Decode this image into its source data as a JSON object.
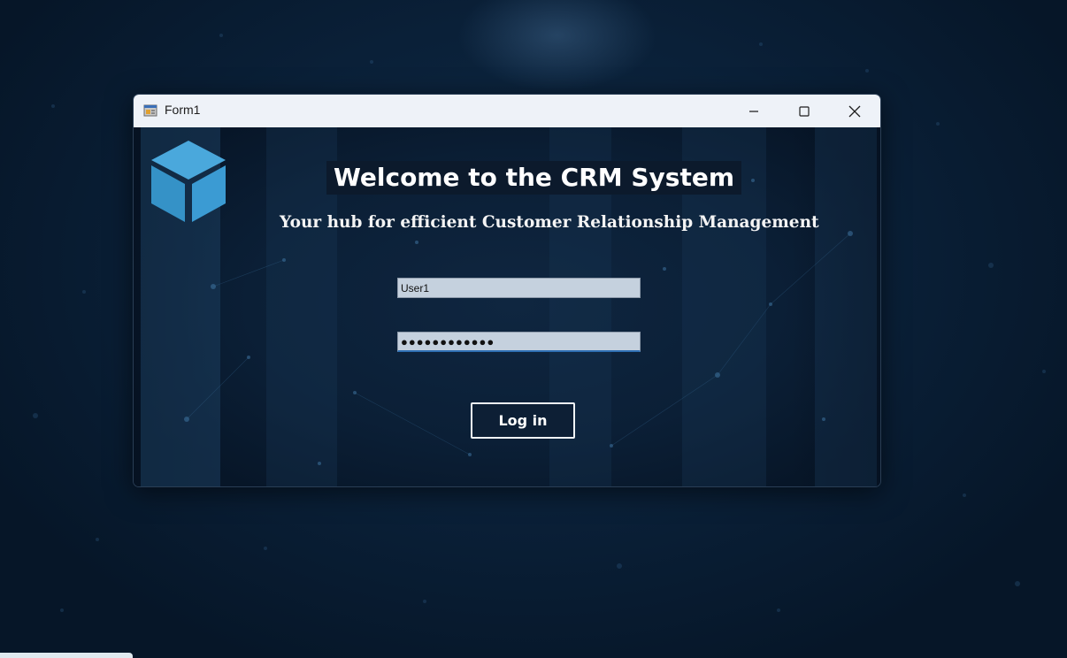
{
  "window": {
    "title": "Form1"
  },
  "titlebar_buttons": {
    "minimize_icon": "minimize-icon",
    "maximize_icon": "maximize-icon",
    "close_icon": "close-icon"
  },
  "header": {
    "logo_icon": "cube-icon",
    "welcome_text": "Welcome to the CRM System",
    "subtitle_text": "Your hub for efficient Customer Relationship Management"
  },
  "login_form": {
    "username_value": "User1",
    "password_value": "●●●●●●●●●●●●",
    "login_button_label": "Log in"
  },
  "colors": {
    "background": "#0a2038",
    "titlebar": "#eef2f8",
    "field_background": "#c5d1de",
    "focus_accent": "#2f6fb3",
    "logo_blue": "#3b9bd3"
  }
}
